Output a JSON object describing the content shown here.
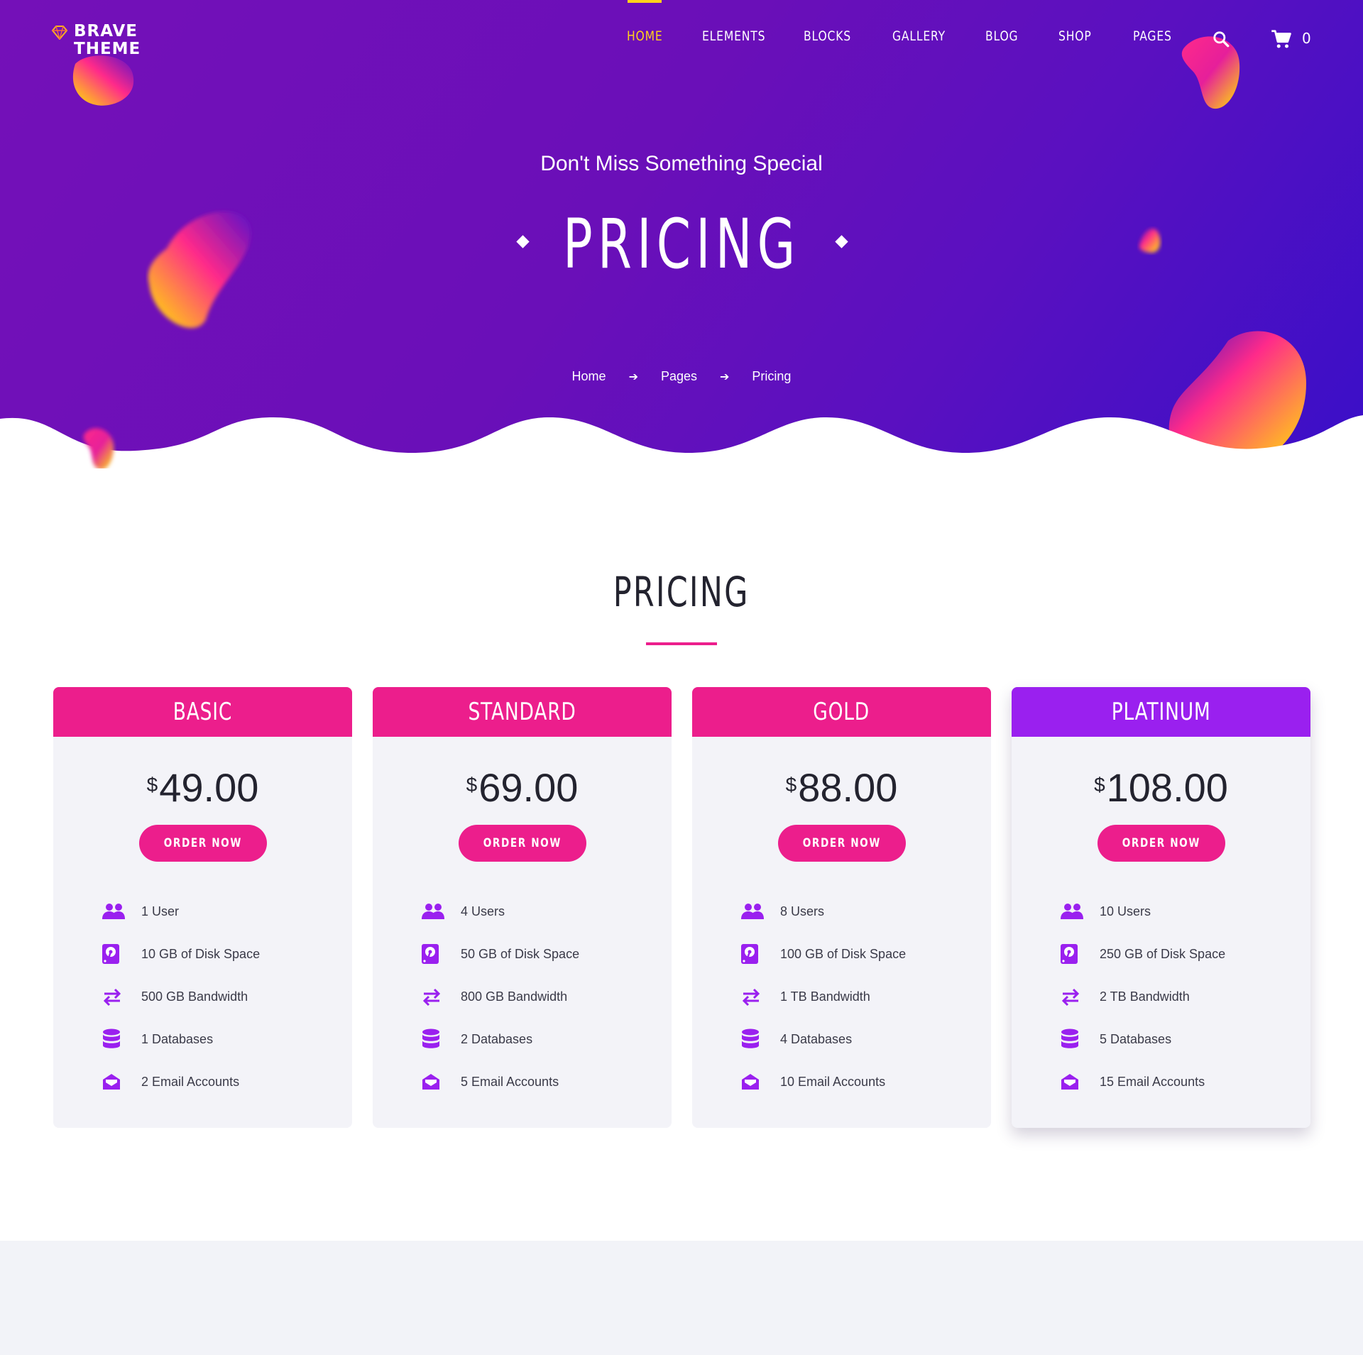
{
  "brand": {
    "line1": "BRAVE",
    "line2": "THEME"
  },
  "nav": {
    "items": [
      "HOME",
      "ELEMENTS",
      "BLOCKS",
      "GALLERY",
      "BLOG",
      "SHOP",
      "PAGES"
    ],
    "cart_count": "0"
  },
  "hero": {
    "subtitle": "Don't Miss Something Special",
    "title": "PRICING",
    "breadcrumb": [
      "Home",
      "Pages",
      "Pricing"
    ]
  },
  "section": {
    "title": "PRICING"
  },
  "plans": [
    {
      "name": "BASIC",
      "currency": "$",
      "price": "49.00",
      "button": "ORDER NOW",
      "features": [
        "1 User",
        "10 GB of Disk Space",
        "500 GB Bandwidth",
        "1 Databases",
        "2 Email Accounts"
      ]
    },
    {
      "name": "STANDARD",
      "currency": "$",
      "price": "69.00",
      "button": "ORDER NOW",
      "features": [
        "4 Users",
        "50 GB of Disk Space",
        "800 GB Bandwidth",
        "2 Databases",
        "5 Email Accounts"
      ]
    },
    {
      "name": "GOLD",
      "currency": "$",
      "price": "88.00",
      "button": "ORDER NOW",
      "features": [
        "8 Users",
        "100 GB of Disk Space",
        "1 TB Bandwidth",
        "4 Databases",
        "10 Email Accounts"
      ]
    },
    {
      "name": "PLATINUM",
      "currency": "$",
      "price": "108.00",
      "button": "ORDER NOW",
      "features": [
        "10 Users",
        "250 GB of Disk Space",
        "2 TB Bandwidth",
        "5 Databases",
        "15 Email Accounts"
      ]
    }
  ],
  "feature_icons": [
    "users-icon",
    "hard-disk-icon",
    "bandwidth-icon",
    "database-icon",
    "email-icon"
  ],
  "colors": {
    "accent": "#ec1e8c",
    "featured": "#9a20ef",
    "nav_active": "#ffd21a",
    "hero": "#6a0fb8",
    "icon": "#9a20ef"
  }
}
